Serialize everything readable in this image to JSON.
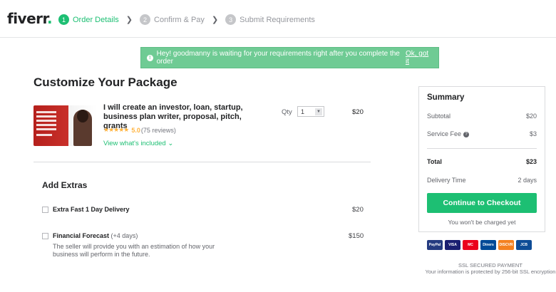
{
  "header": {
    "logo_text": "fiverr",
    "logo_dot": ".",
    "steps": [
      {
        "num": "1",
        "label": "Order Details",
        "active": true
      },
      {
        "num": "2",
        "label": "Confirm & Pay",
        "active": false
      },
      {
        "num": "3",
        "label": "Submit Requirements",
        "active": false
      }
    ]
  },
  "notice": {
    "text": "Hey! goodmanny is waiting for your requirements right after you complete the order",
    "ok_label": "Ok, got it"
  },
  "main": {
    "title": "Customize Your Package",
    "gig": {
      "title": "I will create an investor, loan, startup, business plan writer, proposal, pitch, grants",
      "stars": "★★★★★",
      "score": "5.0",
      "reviews": "(75 reviews)",
      "view_included": "View what's included",
      "qty_label": "Qty",
      "qty_value": "1",
      "price": "$20"
    },
    "extras": {
      "title": "Add Extras",
      "items": [
        {
          "label": "Extra Fast 1 Day Delivery",
          "sub": "",
          "price": "$20"
        },
        {
          "label": "Financial Forecast",
          "sub": "(+4 days)",
          "price": "$150",
          "description": "The seller will provide you with an estimation of how your business will perform in the future."
        }
      ]
    }
  },
  "summary": {
    "title": "Summary",
    "subtotal_label": "Subtotal",
    "subtotal_value": "$20",
    "service_fee_label": "Service Fee",
    "service_fee_value": "$3",
    "total_label": "Total",
    "total_value": "$23",
    "delivery_label": "Delivery Time",
    "delivery_value": "2 days",
    "checkout_label": "Continue to Checkout",
    "no_charge": "You won't be charged yet"
  },
  "payment": {
    "methods": [
      {
        "name": "PayPal",
        "color": "#253b80"
      },
      {
        "name": "VISA",
        "color": "#1a1f71"
      },
      {
        "name": "MC",
        "color": "#eb001b"
      },
      {
        "name": "Diners",
        "color": "#004a97"
      },
      {
        "name": "DISCVR",
        "color": "#f48120"
      },
      {
        "name": "JCB",
        "color": "#0e4c96"
      }
    ],
    "ssl_title": "SSL SECURED PAYMENT",
    "ssl_text": "Your information is protected by 256-bit SSL encryption"
  },
  "colors": {
    "brand_green": "#1dbf73",
    "notice_green": "#6fcb94"
  }
}
